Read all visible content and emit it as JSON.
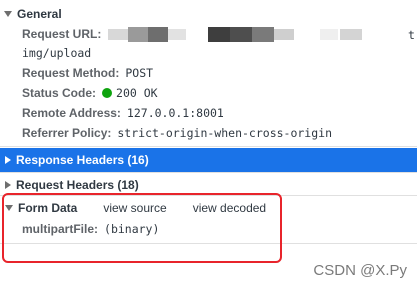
{
  "general": {
    "title": "General",
    "request_url_label": "Request URL:",
    "request_url_tail": "img/upload",
    "request_url_end": "t",
    "request_method_label": "Request Method:",
    "request_method_value": "POST",
    "status_code_label": "Status Code:",
    "status_code_value": "200 OK",
    "remote_address_label": "Remote Address:",
    "remote_address_value": "127.0.0.1:8001",
    "referrer_policy_label": "Referrer Policy:",
    "referrer_policy_value": "strict-origin-when-cross-origin"
  },
  "response_headers": {
    "title": "Response Headers (16)"
  },
  "request_headers": {
    "title": "Request Headers (18)"
  },
  "form_data": {
    "title": "Form Data",
    "view_source": "view source",
    "view_decoded": "view decoded",
    "field_label": "multipartFile:",
    "field_value": "(binary)"
  },
  "watermark": "CSDN @X.Py",
  "colors": {
    "selected_bar": "#1a73e8",
    "status_ok": "#0ea30e",
    "highlight_box": "#e8242b"
  }
}
